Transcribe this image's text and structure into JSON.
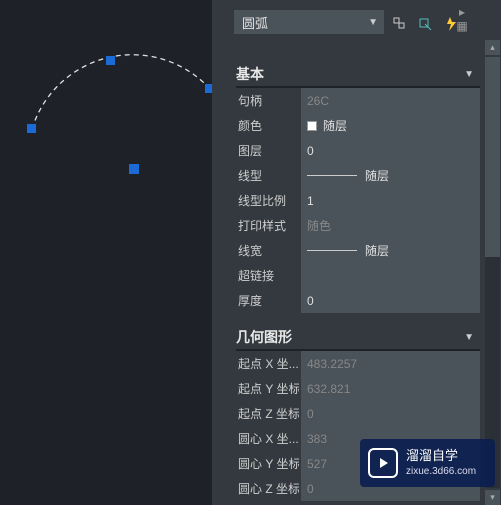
{
  "selector": {
    "label": "圆弧"
  },
  "sections": {
    "basic": {
      "title": "基本",
      "rows": {
        "handle": {
          "label": "句柄",
          "value": "26C"
        },
        "color": {
          "label": "颜色",
          "value": "随层"
        },
        "layer": {
          "label": "图层",
          "value": "0"
        },
        "linetype": {
          "label": "线型",
          "value": "随层"
        },
        "ltscale": {
          "label": "线型比例",
          "value": "1"
        },
        "plotstyle": {
          "label": "打印样式",
          "value": "随色"
        },
        "lineweight": {
          "label": "线宽",
          "value": "随层"
        },
        "hyperlink": {
          "label": "超链接",
          "value": ""
        },
        "thickness": {
          "label": "厚度",
          "value": "0"
        }
      }
    },
    "geom": {
      "title": "几何图形",
      "rows": {
        "sx": {
          "label": "起点 X 坐...",
          "value": "483.2257"
        },
        "sy": {
          "label": "起点 Y 坐标",
          "value": "632.821"
        },
        "sz": {
          "label": "起点 Z 坐标",
          "value": "0"
        },
        "cx": {
          "label": "圆心 X 坐...",
          "value": "383"
        },
        "cy": {
          "label": "圆心 Y 坐标",
          "value": "527"
        },
        "cz": {
          "label": "圆心 Z 坐标",
          "value": "0"
        }
      }
    }
  },
  "watermark": {
    "brand": "溜溜自学",
    "url": "zixue.3d66.com"
  }
}
